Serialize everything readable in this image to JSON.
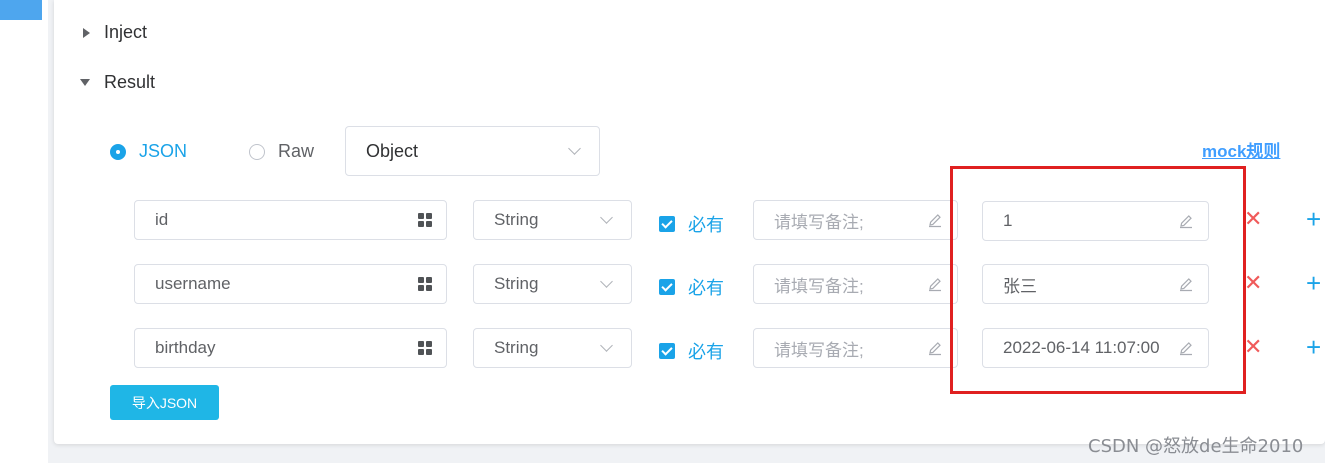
{
  "sections": {
    "inject_label": "Inject",
    "result_label": "Result"
  },
  "format": {
    "json_label": "JSON",
    "raw_label": "Raw",
    "selected": "JSON",
    "type_select": "Object"
  },
  "mock_link": "mock规则",
  "fields": [
    {
      "name": "id",
      "type": "String",
      "required_label": "必有",
      "required": true,
      "remark_placeholder": "请填写备注;",
      "mock": "1"
    },
    {
      "name": "username",
      "type": "String",
      "required_label": "必有",
      "required": true,
      "remark_placeholder": "请填写备注;",
      "mock": "张三"
    },
    {
      "name": "birthday",
      "type": "String",
      "required_label": "必有",
      "required": true,
      "remark_placeholder": "请填写备注;",
      "mock": "2022-06-14 11:07:00"
    }
  ],
  "import_button": "导入JSON",
  "watermark": "CSDN @怒放de生命2010",
  "colors": {
    "accent": "#1aa3e8",
    "link": "#409eff",
    "delete": "#f05a5a",
    "highlight": "#e02020"
  },
  "icons": {
    "expand": "caret-right-icon",
    "collapse": "caret-down-icon",
    "field_settings": "grid-icon",
    "edit": "pencil-icon",
    "delete": "close-icon",
    "add": "plus-icon"
  }
}
